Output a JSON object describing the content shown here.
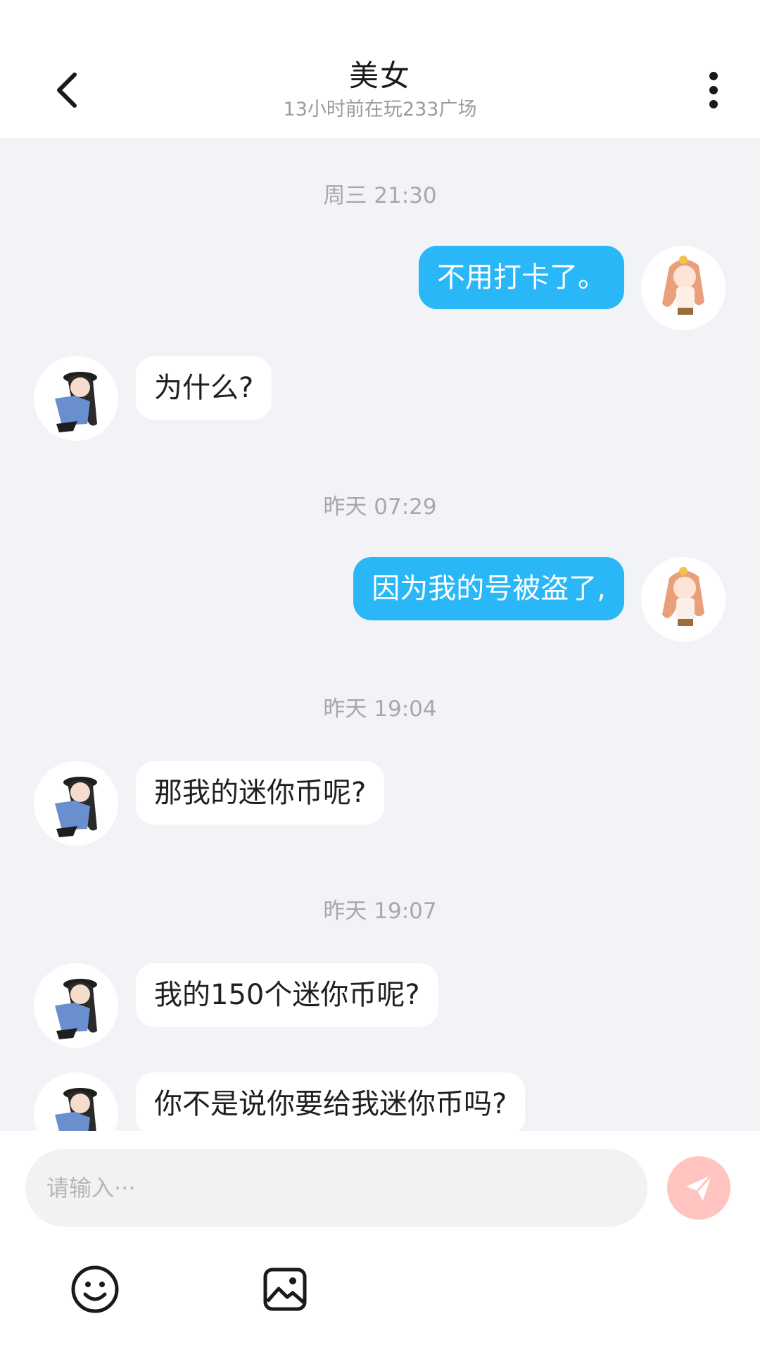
{
  "header": {
    "title": "美女",
    "subtitle": "13小时前在玩233广场",
    "back_icon": "chevron-left-icon",
    "menu_icon": "more-vertical-icon"
  },
  "messages": [
    {
      "type": "timestamp",
      "text": "周三 21:30"
    },
    {
      "type": "message",
      "side": "mine",
      "text": "不用打卡了。"
    },
    {
      "type": "message",
      "side": "theirs",
      "text": "为什么?"
    },
    {
      "type": "timestamp",
      "text": "昨天 07:29"
    },
    {
      "type": "message",
      "side": "mine",
      "text": "因为我的号被盗了,"
    },
    {
      "type": "timestamp",
      "text": "昨天 19:04"
    },
    {
      "type": "message",
      "side": "theirs",
      "text": "那我的迷你币呢?"
    },
    {
      "type": "timestamp",
      "text": "昨天 19:07"
    },
    {
      "type": "message",
      "side": "theirs",
      "text": "我的150个迷你币呢?"
    },
    {
      "type": "message",
      "side": "theirs",
      "text": "你不是说你要给我迷你币吗?"
    }
  ],
  "composer": {
    "placeholder": "请输入···",
    "send_icon": "send-icon",
    "emoji_icon": "emoji-icon",
    "image_icon": "image-icon"
  },
  "colors": {
    "my_bubble": "#29b7f8",
    "their_bubble": "#ffffff",
    "chat_background": "#f2f3f7",
    "send_button": "#ffc4c0"
  }
}
